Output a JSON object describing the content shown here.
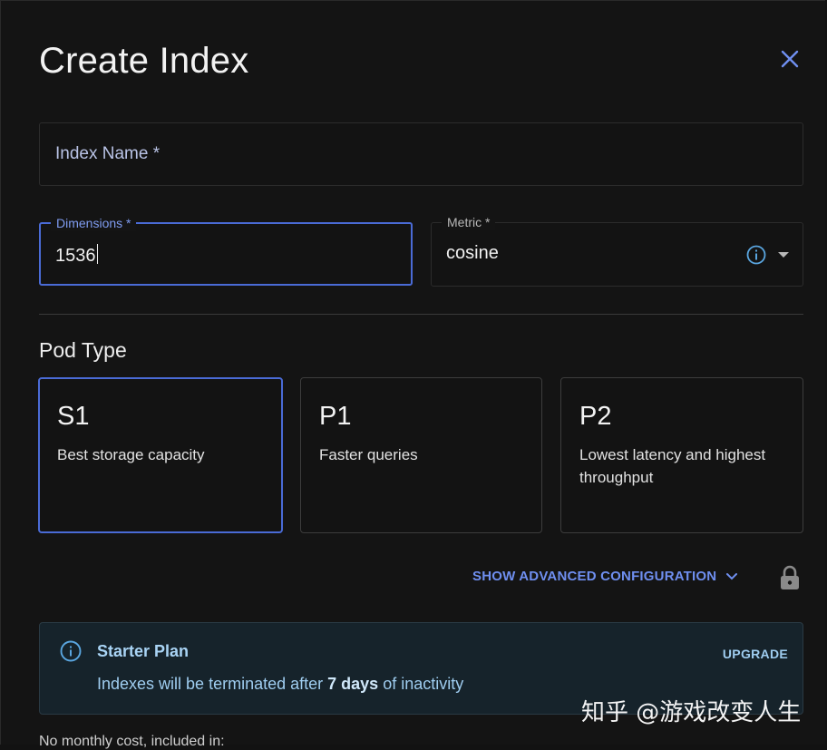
{
  "dialog": {
    "title": "Create Index",
    "close_icon": "close-icon"
  },
  "form": {
    "index_name": {
      "placeholder": "Index Name *",
      "value": ""
    },
    "dimensions": {
      "label": "Dimensions *",
      "value": "1536"
    },
    "metric": {
      "label": "Metric *",
      "value": "cosine",
      "icons": [
        "info-icon",
        "chevron-down-icon"
      ]
    }
  },
  "pod_type": {
    "title": "Pod Type",
    "options": [
      {
        "name": "S1",
        "description": "Best storage capacity",
        "selected": true
      },
      {
        "name": "P1",
        "description": "Faster queries",
        "selected": false
      },
      {
        "name": "P2",
        "description": "Lowest latency and highest throughput",
        "selected": false
      }
    ]
  },
  "advanced": {
    "label": "SHOW ADVANCED CONFIGURATION",
    "icons": [
      "chevron-down-icon",
      "lock-icon"
    ]
  },
  "plan": {
    "title": "Starter Plan",
    "desc_before": "Indexes will be terminated after ",
    "desc_bold": "7 days",
    "desc_after": " of inactivity",
    "upgrade_label": "UPGRADE",
    "icon": "info-icon"
  },
  "footer": {
    "text": "No monthly cost, included in:"
  },
  "watermark": {
    "text": "知乎 @游戏改变人生"
  },
  "colors": {
    "accent": "#4a6bd6",
    "link": "#6f8ff0",
    "plan_bg": "#16232b",
    "plan_text": "#9fcdf0"
  }
}
